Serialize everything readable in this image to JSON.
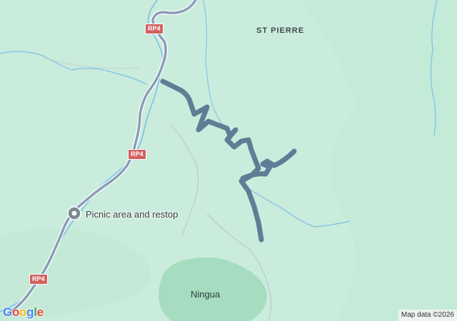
{
  "map": {
    "town_label": "ST PIERRE",
    "place_label": "Ningua",
    "poi": {
      "name": "Picnic area and restop",
      "icon": "picnic-pin-icon"
    },
    "road_shields": [
      "RP4",
      "RP4",
      "RP4"
    ],
    "logo_text": "Google",
    "logo_letters": [
      "G",
      "o",
      "o",
      "g",
      "l",
      "e"
    ],
    "logo_colors": [
      "#4285f4",
      "#ea4335",
      "#fbbc05",
      "#4285f4",
      "#34a853",
      "#ea4335"
    ],
    "attribution": "Map data ©2026",
    "colors": {
      "terrain": "#c9ecdc",
      "forest": "#a6dcc0",
      "water": "#7cc0e8",
      "road": "#8a9cb4",
      "track": "#5f7d94"
    }
  }
}
